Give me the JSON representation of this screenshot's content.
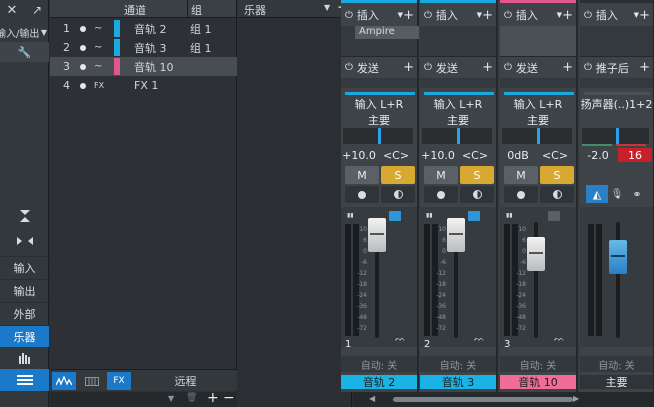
{
  "nav": {
    "close_glyph": "✕",
    "expand_glyph": "↗",
    "io_label": "输入/输出",
    "items": [
      {
        "label": "输入"
      },
      {
        "label": "输出"
      },
      {
        "label": "外部"
      },
      {
        "label": "乐器"
      }
    ]
  },
  "list": {
    "header_channel": "通道",
    "header_group": "组",
    "rows": [
      {
        "num": "1",
        "wave": "~",
        "name": "音轨 2",
        "group": "组 1",
        "color": "#1aa9e0"
      },
      {
        "num": "2",
        "wave": "~",
        "name": "音轨 3",
        "group": "组 1",
        "color": "#1aa9e0"
      },
      {
        "num": "3",
        "wave": "~",
        "name": "音轨 10",
        "group": "",
        "color": "#e0578f"
      },
      {
        "num": "4",
        "wave": "FX",
        "name": "FX 1",
        "group": "",
        "color": ""
      }
    ],
    "footer_fx": "FX",
    "footer_remote": "远程"
  },
  "instruments": {
    "title": "乐器",
    "add": "+"
  },
  "mixer": {
    "strips": [
      {
        "insert_label": "插入",
        "insert_item": "Ampire",
        "send_label": "发送",
        "input": "输入 L+R",
        "output": "主要",
        "volume": "+10.0",
        "pan": "<C>",
        "m": "M",
        "s": "S",
        "number": "1",
        "auto": "自动: 关",
        "name": "音轨 2",
        "name_color": "#1ab3e6"
      },
      {
        "insert_label": "插入",
        "insert_item": "",
        "send_label": "发送",
        "input": "输入 L+R",
        "output": "主要",
        "volume": "+10.0",
        "pan": "<C>",
        "m": "M",
        "s": "S",
        "number": "2",
        "auto": "自动: 关",
        "name": "音轨 3",
        "name_color": "#1ab3e6"
      },
      {
        "insert_label": "插入",
        "insert_item": "",
        "send_label": "发送",
        "input": "输入 L+R",
        "output": "主要",
        "volume": "0dB",
        "pan": "<C>",
        "m": "M",
        "s": "S",
        "number": "3",
        "auto": "自动: 关",
        "name": "音轨 10",
        "name_color": "#f06d9a"
      },
      {
        "insert_label": "插入",
        "insert_item": "",
        "send_label": "推子后",
        "input": "扬声器(..)1+2",
        "output": "",
        "volume": "-2.0",
        "pan": "16",
        "m": "",
        "s": "",
        "number": "",
        "auto": "自动: 关",
        "name": "主要",
        "name_color": "#2f3438"
      }
    ],
    "scale": [
      "10",
      "6",
      "0",
      "-6",
      "-12",
      "-18",
      "-24",
      "-36",
      "-48",
      "-72"
    ]
  }
}
